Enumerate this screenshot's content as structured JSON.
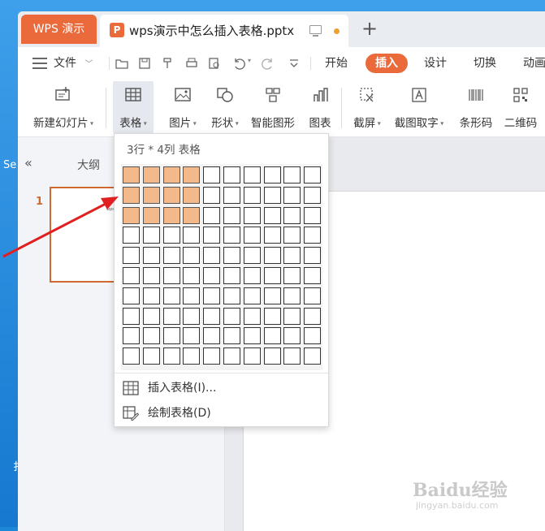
{
  "desktop": {
    "side_chars": [
      "Se",
      "扌"
    ]
  },
  "tabs": {
    "app_label": "WPS 演示",
    "doc_icon": "P",
    "doc_title": "wps演示中怎么插入表格.pptx",
    "add": "+"
  },
  "menu": {
    "file": "文件",
    "tabs": [
      {
        "label": "开始",
        "active": false
      },
      {
        "label": "插入",
        "active": true
      },
      {
        "label": "设计",
        "active": false
      },
      {
        "label": "切换",
        "active": false
      },
      {
        "label": "动画",
        "active": false
      }
    ]
  },
  "ribbon": {
    "new_slide": "新建幻灯片",
    "table": "表格",
    "picture": "图片",
    "shape": "形状",
    "smartart": "智能图形",
    "chart": "图表",
    "screenshot": "截屏",
    "capture_text": "截图取字",
    "barcode": "条形码",
    "qrcode": "二维码"
  },
  "left_panel": {
    "collapse": "«",
    "outline_tab": "大纲",
    "slide_number": "1",
    "thumb_text": "wps"
  },
  "dropdown": {
    "header": "3行 * 4列 表格",
    "grid": {
      "rows": 10,
      "cols": 10,
      "selected_rows": 3,
      "selected_cols": 4
    },
    "items": [
      {
        "label": "插入表格(I)...",
        "icon": "table-icon"
      },
      {
        "label": "绘制表格(D)",
        "icon": "draw-table-icon"
      }
    ]
  },
  "watermark": {
    "logo": "Baidu经验",
    "url": "jingyan.baidu.com"
  },
  "colors": {
    "accent": "#ea6a3b",
    "cell_selected": "#f3b98b",
    "arrow": "#e02020"
  }
}
